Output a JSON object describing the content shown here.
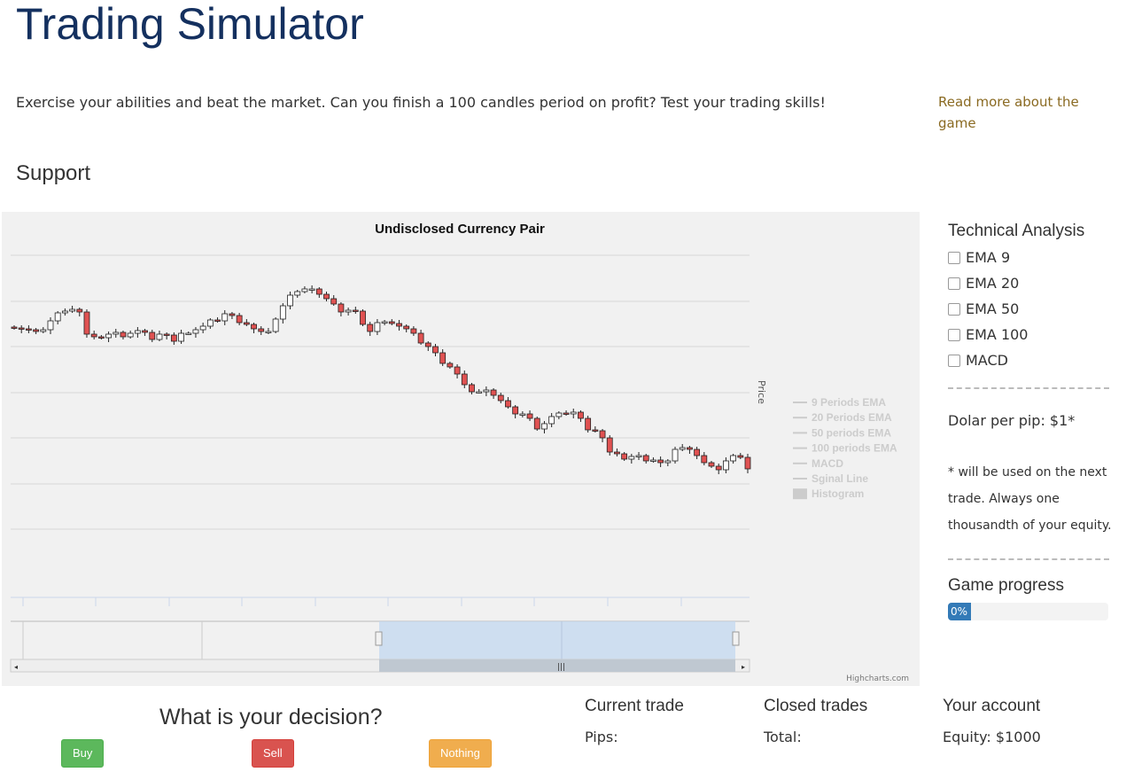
{
  "page": {
    "title": "Trading Simulator",
    "intro": "Exercise your abilities and beat the market. Can you finish a 100 candles period on profit? Test your trading skills!",
    "read_more": "Read more about the game",
    "section": "Support"
  },
  "chart": {
    "title": "Undisclosed Currency Pair",
    "y_axis_title": "Price",
    "credits": "Highcharts.com",
    "legend": [
      {
        "label": "9 Periods EMA",
        "symbol": "line"
      },
      {
        "label": "20 Periods EMA",
        "symbol": "line"
      },
      {
        "label": "50 periods EMA",
        "symbol": "line"
      },
      {
        "label": "100 periods EMA",
        "symbol": "line"
      },
      {
        "label": "MACD",
        "symbol": "line"
      },
      {
        "label": "Sginal Line",
        "symbol": "line"
      },
      {
        "label": "Histogram",
        "symbol": "box"
      }
    ]
  },
  "chart_data": {
    "type": "candlestick",
    "title": "Undisclosed Currency Pair",
    "ylabel": "Price",
    "grid": true,
    "legend_placement": "right",
    "colors": {
      "up": "#ffffff",
      "down": "#e05252"
    },
    "close": [
      230,
      229,
      228,
      226,
      228,
      238,
      247,
      249,
      251,
      248,
      223,
      220,
      219,
      223,
      225,
      220,
      224,
      227,
      225,
      217,
      223,
      222,
      215,
      224,
      224,
      228,
      232,
      239,
      238,
      246,
      244,
      236,
      234,
      229,
      226,
      226,
      240,
      255,
      267,
      271,
      274,
      274,
      268,
      263,
      257,
      248,
      250,
      249,
      234,
      226,
      236,
      237,
      235,
      232,
      229,
      224,
      213,
      209,
      202,
      190,
      186,
      178,
      166,
      158,
      158,
      160,
      154,
      148,
      141,
      133,
      133,
      128,
      116,
      122,
      130,
      134,
      133,
      135,
      128,
      115,
      114,
      106,
      90,
      88,
      82,
      85,
      86,
      80,
      81,
      78,
      80,
      93,
      95,
      93,
      86,
      78,
      74,
      70,
      80,
      86,
      84,
      71
    ]
  },
  "sidebar": {
    "technical_title": "Technical Analysis",
    "indicators": [
      {
        "label": "EMA 9",
        "checked": false
      },
      {
        "label": "EMA 20",
        "checked": false
      },
      {
        "label": "EMA 50",
        "checked": false
      },
      {
        "label": "EMA 100",
        "checked": false
      },
      {
        "label": "MACD",
        "checked": false
      }
    ],
    "pip": "Dolar per pip: $1*",
    "note": "* will be used on the next trade. Always one thousandth of your equity.",
    "progress_title": "Game progress",
    "progress_label": "0%",
    "progress_value": 0
  },
  "decision": {
    "title": "What is your decision?",
    "buy": "Buy",
    "sell": "Sell",
    "nothing": "Nothing",
    "colors": {
      "buy": "#5cb85c",
      "sell": "#d9534f",
      "nothing": "#f0ad4e"
    }
  },
  "current_trade": {
    "title": "Current trade",
    "pips": "Pips:"
  },
  "closed_trades": {
    "title": "Closed trades",
    "total": "Total:"
  },
  "account": {
    "title": "Your account",
    "equity": "Equity: $1000"
  }
}
